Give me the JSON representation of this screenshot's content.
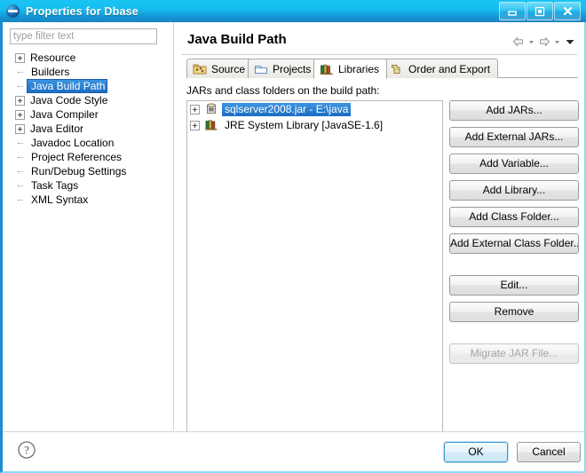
{
  "window": {
    "title": "Properties for Dbase",
    "icon": "eclipse-icon",
    "controls": [
      {
        "name": "minimize-button",
        "glyph": "minimize-icon"
      },
      {
        "name": "maximize-button",
        "glyph": "maximize-icon"
      },
      {
        "name": "close-button",
        "glyph": "close-icon"
      }
    ]
  },
  "sidebar": {
    "filter": {
      "value": "",
      "placeholder": "type filter text"
    },
    "items": [
      {
        "label": "Resource",
        "expandable": true,
        "selected": false
      },
      {
        "label": "Builders",
        "expandable": false,
        "selected": false
      },
      {
        "label": "Java Build Path",
        "expandable": false,
        "selected": true
      },
      {
        "label": "Java Code Style",
        "expandable": true,
        "selected": false
      },
      {
        "label": "Java Compiler",
        "expandable": true,
        "selected": false
      },
      {
        "label": "Java Editor",
        "expandable": true,
        "selected": false
      },
      {
        "label": "Javadoc Location",
        "expandable": false,
        "selected": false
      },
      {
        "label": "Project References",
        "expandable": false,
        "selected": false
      },
      {
        "label": "Run/Debug Settings",
        "expandable": false,
        "selected": false
      },
      {
        "label": "Task Tags",
        "expandable": false,
        "selected": false
      },
      {
        "label": "XML Syntax",
        "expandable": false,
        "selected": false
      }
    ]
  },
  "page": {
    "title": "Java Build Path",
    "nav": [
      {
        "name": "back-arrow-icon"
      },
      {
        "name": "back-dropdown-caret-icon"
      },
      {
        "name": "forward-arrow-icon"
      },
      {
        "name": "forward-dropdown-caret-icon"
      },
      {
        "name": "menu-chevron-down-icon"
      }
    ]
  },
  "tabs": [
    {
      "label": "Source",
      "icon": "source-folder-icon",
      "active": false
    },
    {
      "label": "Projects",
      "icon": "projects-icon",
      "active": false
    },
    {
      "label": "Libraries",
      "icon": "libraries-icon",
      "active": true
    },
    {
      "label": "Order and Export",
      "icon": "order-export-icon",
      "active": false
    }
  ],
  "libraries": {
    "section_label": "JARs and class folders on the build path:",
    "entries": [
      {
        "label": "sqlserver2008.jar  - E:\\java",
        "icon": "jar-icon",
        "selected": true,
        "expandable": true
      },
      {
        "label": "JRE System Library [JavaSE-1.6]",
        "icon": "library-icon",
        "selected": false,
        "expandable": true
      }
    ],
    "buttons": [
      {
        "label": "Add JARs...",
        "name": "add-jars-button",
        "enabled": true,
        "gap": false
      },
      {
        "label": "Add External JARs...",
        "name": "add-external-jars-button",
        "enabled": true,
        "gap": false
      },
      {
        "label": "Add Variable...",
        "name": "add-variable-button",
        "enabled": true,
        "gap": false
      },
      {
        "label": "Add Library...",
        "name": "add-library-button",
        "enabled": true,
        "gap": false
      },
      {
        "label": "Add Class Folder...",
        "name": "add-class-folder-button",
        "enabled": true,
        "gap": false
      },
      {
        "label": "Add External Class Folder...",
        "name": "add-external-class-folder-button",
        "enabled": true,
        "gap": false
      },
      {
        "label": "Edit...",
        "name": "edit-button",
        "enabled": true,
        "gap": true
      },
      {
        "label": "Remove",
        "name": "remove-button",
        "enabled": true,
        "gap": false
      },
      {
        "label": "Migrate JAR File...",
        "name": "migrate-jar-file-button",
        "enabled": false,
        "gap": true
      }
    ]
  },
  "footer": {
    "help_icon": "help-icon",
    "ok_label": "OK",
    "cancel_label": "Cancel"
  },
  "colors": {
    "titlebar_start": "#18c5f3",
    "titlebar_end": "#1b86c3",
    "selection": "#2d7dd2",
    "ok_border": "#3e97cd"
  }
}
